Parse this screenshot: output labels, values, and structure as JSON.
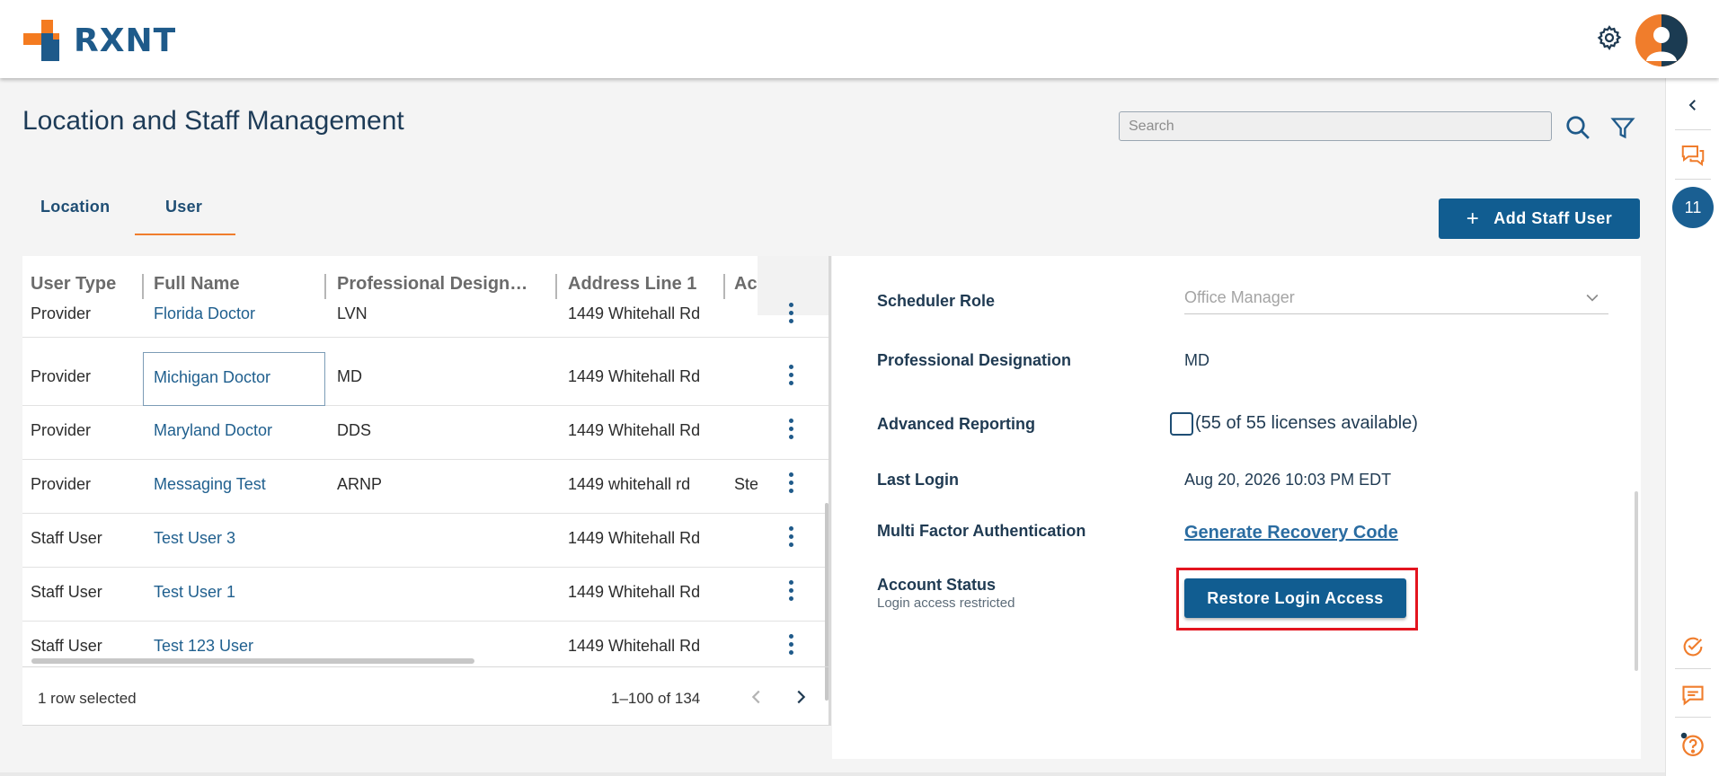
{
  "header": {
    "logo_text": "RXNT",
    "gear_icon": "gear-icon",
    "avatar_icon": "user-avatar-icon"
  },
  "page": {
    "title": "Location and Staff Management",
    "search_placeholder": "Search",
    "search_value": ""
  },
  "tabs": [
    {
      "label": "Location",
      "active": false
    },
    {
      "label": "User",
      "active": true
    }
  ],
  "add_button": {
    "icon": "+",
    "label": "Add Staff User"
  },
  "grid": {
    "columns": [
      "User Type",
      "Full Name",
      "Professional Design…",
      "Address Line 1",
      "Ac"
    ],
    "rows": [
      {
        "user_type": "Provider",
        "full_name": "Florida Doctor",
        "designation": "LVN",
        "address": "1449 Whitehall Rd",
        "address2": ""
      },
      {
        "user_type": "Provider",
        "full_name": "Michigan Doctor",
        "designation": "MD",
        "address": "1449 Whitehall Rd",
        "address2": ""
      },
      {
        "user_type": "Provider",
        "full_name": "Maryland Doctor",
        "designation": "DDS",
        "address": "1449 Whitehall Rd",
        "address2": ""
      },
      {
        "user_type": "Provider",
        "full_name": "Messaging Test",
        "designation": "ARNP",
        "address": "1449 whitehall rd",
        "address2": "Ste"
      },
      {
        "user_type": "Staff User",
        "full_name": "Test User 3",
        "designation": "",
        "address": "1449 Whitehall Rd",
        "address2": ""
      },
      {
        "user_type": "Staff User",
        "full_name": "Test User 1",
        "designation": "",
        "address": "1449 Whitehall Rd",
        "address2": ""
      },
      {
        "user_type": "Staff User",
        "full_name": "Test 123 User",
        "designation": "",
        "address": "1449 Whitehall Rd",
        "address2": ""
      }
    ],
    "footer": {
      "selected_text": "1 row selected",
      "range_text": "1–100 of 134"
    }
  },
  "detail": {
    "scheduler_role_label": "Scheduler Role",
    "scheduler_role_value": "Office Manager",
    "prof_designation_label": "Professional Designation",
    "prof_designation_value": "MD",
    "advanced_reporting_label": "Advanced Reporting",
    "advanced_reporting_text": "(55 of 55 licenses available)",
    "advanced_reporting_checked": false,
    "last_login_label": "Last Login",
    "last_login_value": "Aug 20, 2026 10:03 PM EDT",
    "mfa_label": "Multi Factor Authentication",
    "mfa_link": "Generate Recovery Code",
    "account_status_label": "Account Status",
    "account_status_sub": "Login access restricted",
    "restore_button": "Restore Login Access"
  },
  "rail": {
    "collapse_icon": "chevron-left-icon",
    "chat_icon": "chat-bubbles-icon",
    "notification_count": "11",
    "tasks_icon": "check-circle-icon",
    "messages_icon": "message-icon",
    "help_icon": "help-icon"
  },
  "colors": {
    "primary": "#115d91",
    "accent": "#f07d2c",
    "highlight": "#e3141f"
  }
}
